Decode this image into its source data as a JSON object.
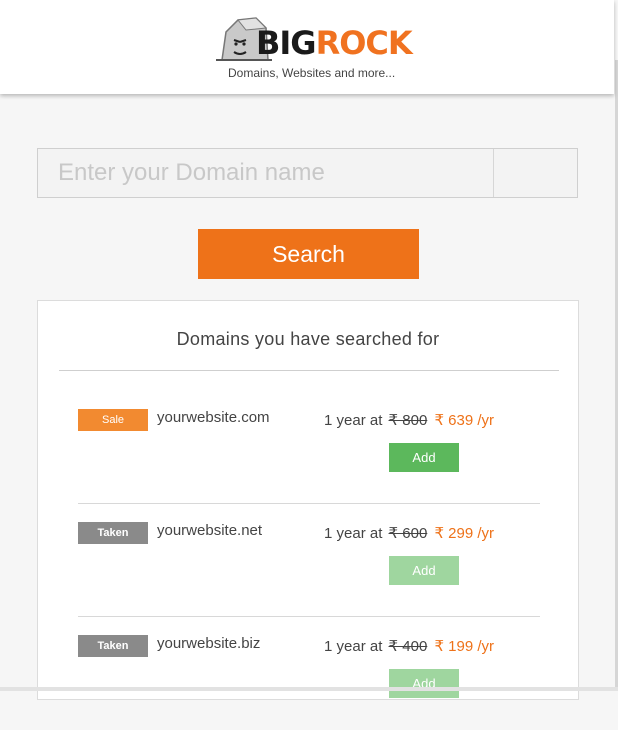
{
  "brand": {
    "word_big": "BIG",
    "word_rock": "ROCK",
    "tagline": "Domains, Websites and more...",
    "colors": {
      "orange": "#ee7219",
      "dark": "#1a1a1a"
    }
  },
  "search": {
    "placeholder": "Enter your Domain name",
    "value": "",
    "button_label": "Search"
  },
  "results": {
    "title": "Domains you have searched for",
    "rows": [
      {
        "status": "Sale",
        "domain": "yourwebsite.com",
        "term": "1 year at",
        "old_price": "₹ 800",
        "new_price": "₹ 639 /yr",
        "add_label": "Add",
        "add_enabled": true
      },
      {
        "status": "Taken",
        "domain": "yourwebsite.net",
        "term": "1 year at",
        "old_price": "₹ 600",
        "new_price": "₹ 299 /yr",
        "add_label": "Add",
        "add_enabled": false
      },
      {
        "status": "Taken",
        "domain": "yourwebsite.biz",
        "term": "1 year at",
        "old_price": "₹ 400",
        "new_price": "₹ 199 /yr",
        "add_label": "Add",
        "add_enabled": false
      }
    ]
  }
}
